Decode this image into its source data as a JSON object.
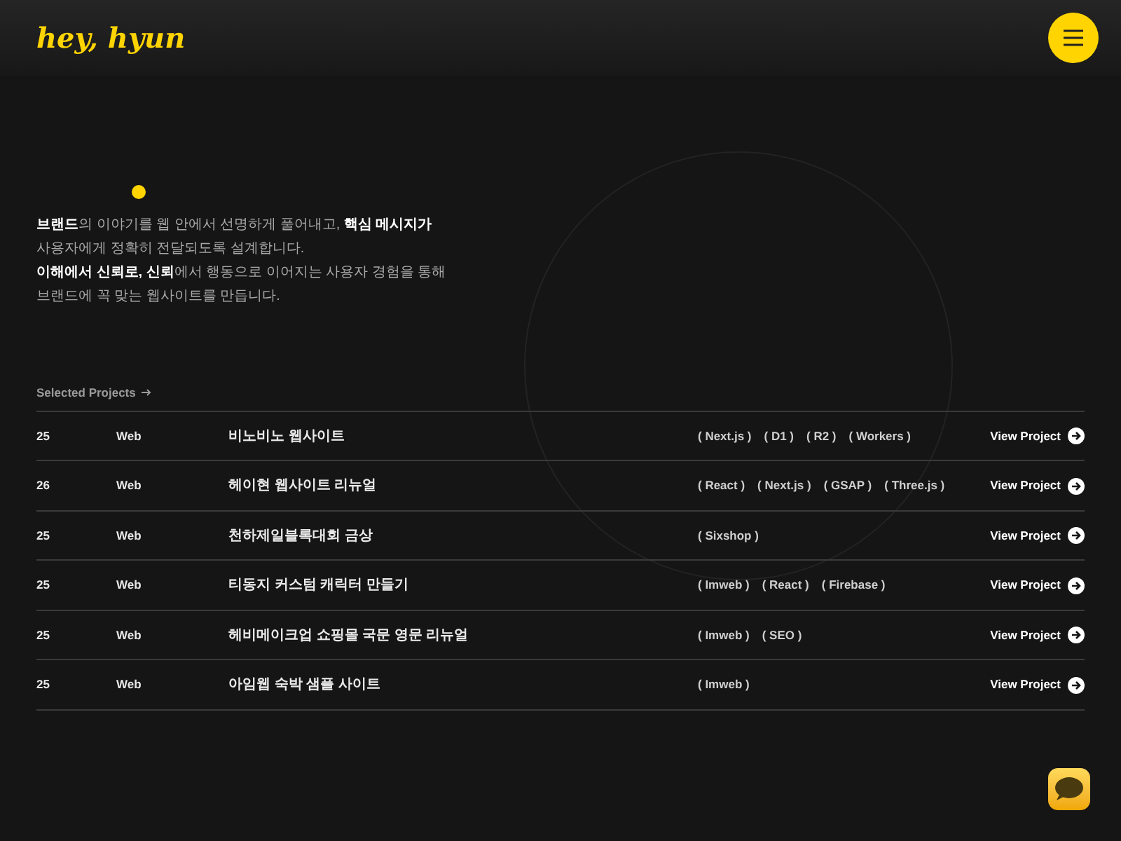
{
  "header": {
    "logo": "hey, hyun"
  },
  "intro": {
    "lines": [
      "**브랜드**의 이야기를 웹 안에서 선명하게 풀어내고, **핵심 메시지가**",
      "사용자에게 정확히 전달되도록 설계합니다.",
      "**이해에서 신뢰로, 신뢰**에서 행동으로 이어지는 사용자 경험을 통해",
      "브랜드에 꼭 맞는 웹사이트를 만듭니다."
    ]
  },
  "projects": {
    "heading": "Selected Projects",
    "rows": [
      {
        "year": "25",
        "type": "Web",
        "title": "비노비노 웹사이트",
        "tags": [
          "( Next.js )",
          "( D1 )",
          "( R2 )",
          "( Workers )"
        ],
        "link": "View Project"
      },
      {
        "year": "26",
        "type": "Web",
        "title": "헤이현 웹사이트 리뉴얼",
        "tags": [
          "( React )",
          "( Next.js )",
          "( GSAP )",
          "( Three.js )"
        ],
        "link": "View Project"
      },
      {
        "year": "25",
        "type": "Web",
        "title": "천하제일블록대회 금상",
        "tags": [
          "( Sixshop )"
        ],
        "link": "View Project"
      },
      {
        "year": "25",
        "type": "Web",
        "title": "티동지 커스텀 캐릭터 만들기",
        "tags": [
          "( Imweb )",
          "( React )",
          "( Firebase )"
        ],
        "link": "View Project"
      },
      {
        "year": "25",
        "type": "Web",
        "title": "헤비메이크업 쇼핑몰 국문 영문 리뉴얼",
        "tags": [
          "( Imweb )",
          "( SEO )"
        ],
        "link": "View Project"
      },
      {
        "year": "25",
        "type": "Web",
        "title": "아임웹 숙박 샘플 사이트",
        "tags": [
          "( Imweb )"
        ],
        "link": "View Project"
      }
    ]
  }
}
